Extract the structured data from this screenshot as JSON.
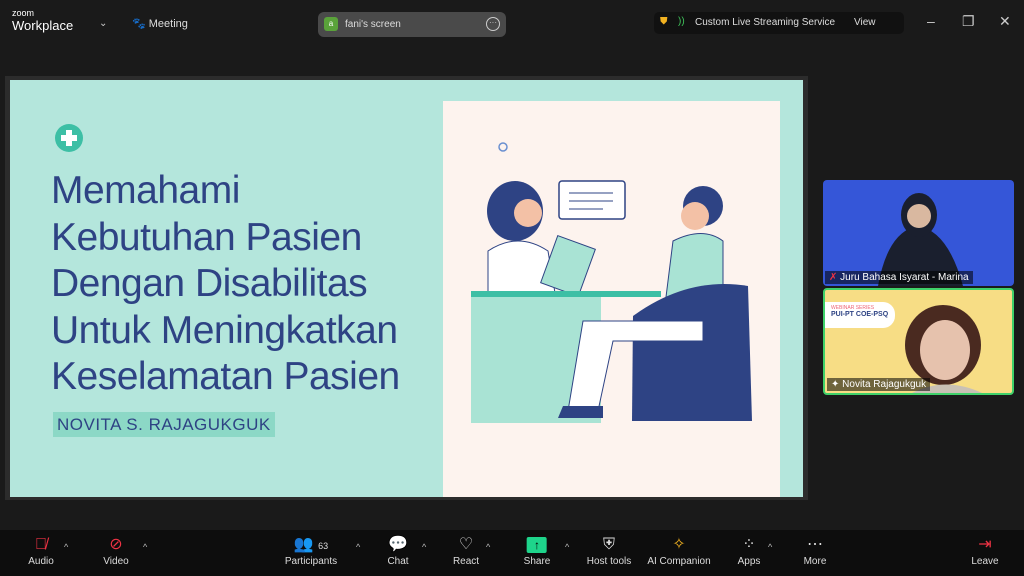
{
  "topbar": {
    "logo_small": "zoom",
    "logo_big": "Workplace",
    "meeting": "Meeting",
    "screen_avatar": "a",
    "screen_label": "fani's screen",
    "stream_label": "Custom Live Streaming Service",
    "view_label": "View"
  },
  "slide": {
    "title_lines": [
      "Memahami",
      "Kebutuhan Pasien",
      "Dengan Disabilitas",
      "Untuk Meningkatkan",
      "Keselamatan Pasien"
    ],
    "presenter": "NOVITA S. RAJAGUKGUK",
    "colors": {
      "bg": "#b4e6dc",
      "title": "#2e4384",
      "accent": "#3dbfa5"
    }
  },
  "participants": [
    {
      "name": "Juru Bahasa Isyarat - Marina"
    },
    {
      "name": "Novita Rajagukguk",
      "banner_series": "WEBINAR SERIES",
      "banner_title": "PUI-PT COE-PSQ"
    }
  ],
  "toolbar": {
    "audio": "Audio",
    "video": "Video",
    "participants": "Participants",
    "participants_count": "63",
    "chat": "Chat",
    "react": "React",
    "share": "Share",
    "host_tools": "Host tools",
    "ai_companion": "AI Companion",
    "apps": "Apps",
    "more": "More",
    "leave": "Leave"
  }
}
